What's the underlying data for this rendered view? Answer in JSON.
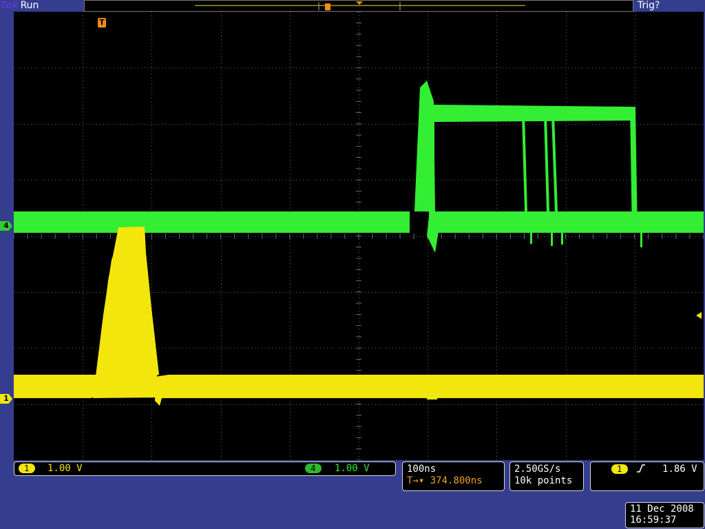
{
  "header": {
    "brand": "Tek",
    "run_status": "Run",
    "trigger_status": "Trig?"
  },
  "markers": {
    "ch4": "4",
    "ch1": "1",
    "trigger_pos": "T"
  },
  "channels": {
    "ch1": {
      "label": "1",
      "scale": "1.00 V",
      "color": "#f2e60c"
    },
    "ch4": {
      "label": "4",
      "scale": "1.00 V",
      "color": "#33ee33"
    }
  },
  "horizontal": {
    "timebase": "100ns",
    "delay": "374.800ns",
    "delay_prefix": "T→▾"
  },
  "acquisition": {
    "sample_rate": "2.50GS/s",
    "record_length": "10k points"
  },
  "trigger": {
    "source": "1",
    "slope": "rising",
    "level": "1.86 V"
  },
  "datetime": {
    "date": "11 Dec 2008",
    "time": "16:59:37"
  }
}
